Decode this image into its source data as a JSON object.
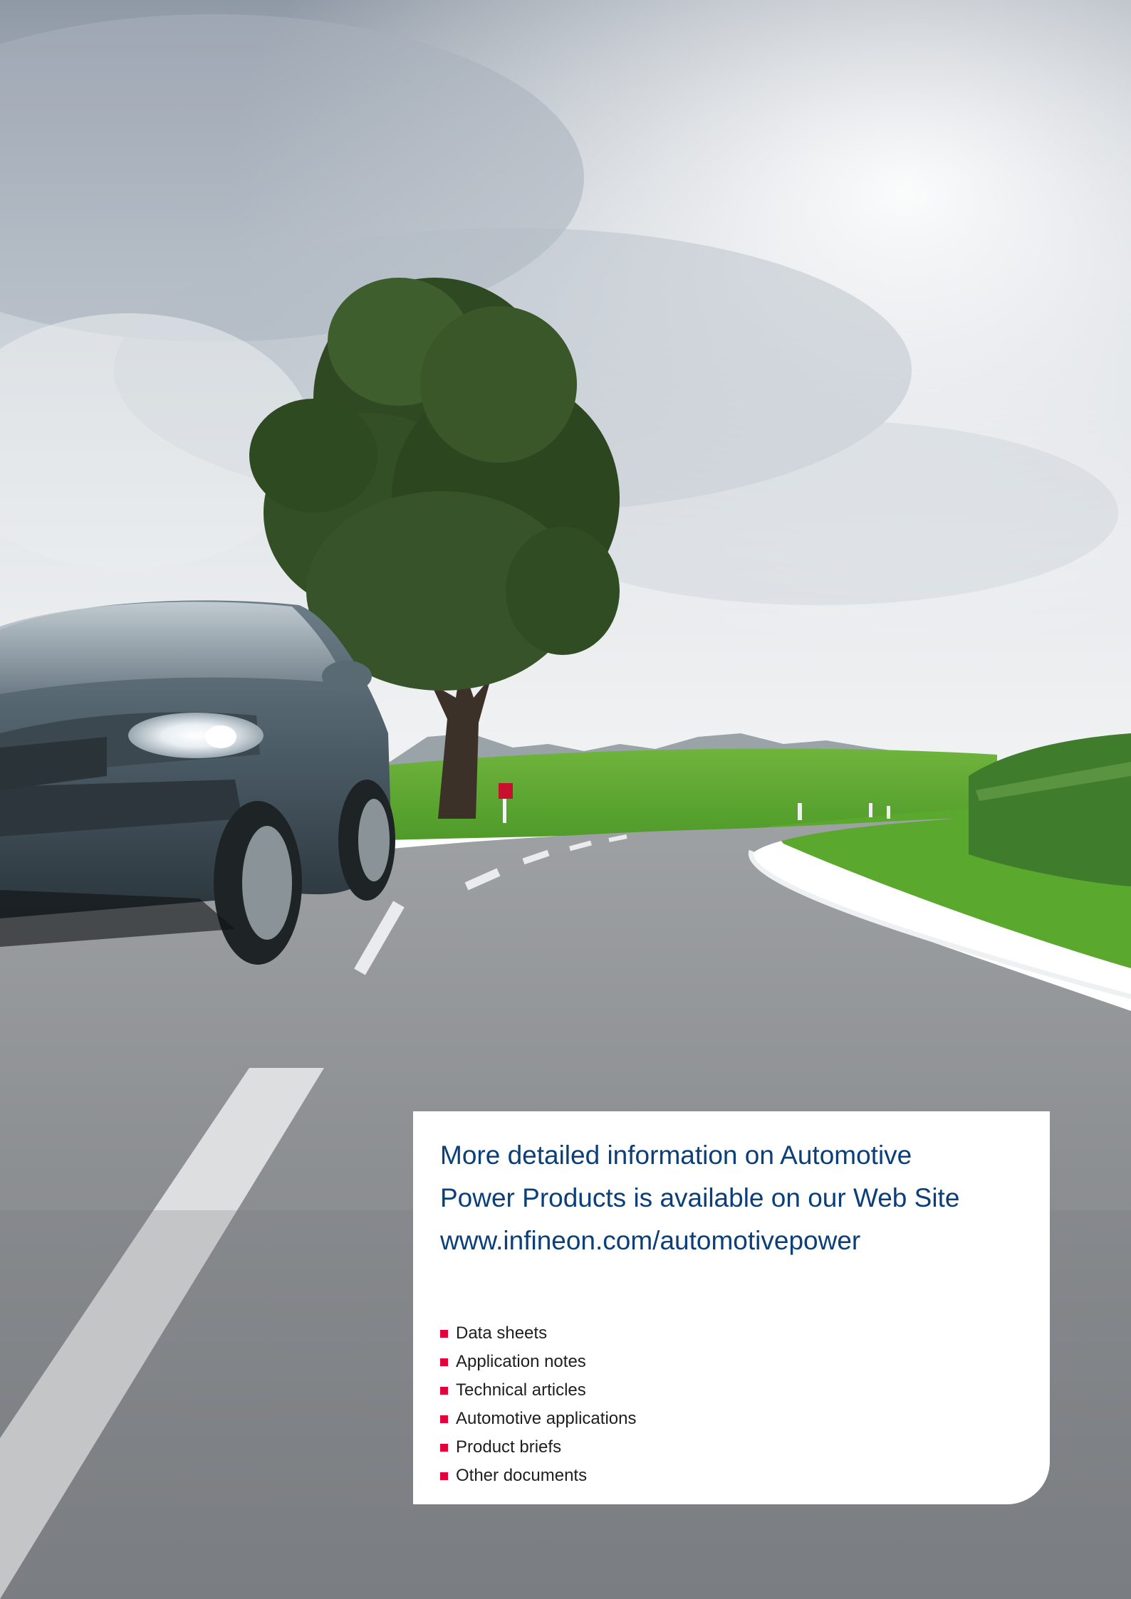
{
  "colors": {
    "heading": "#0b3f7a",
    "bullet": "#e3003a",
    "list_text": "#1e1e1e",
    "card": "#ffffff"
  },
  "photo": {
    "subject": "car-on-country-road-with-tree"
  },
  "info_box": {
    "heading_lines": [
      "More detailed information on Automotive",
      "Power Products is available on our Web Site",
      "www.infineon.com/automotivepower"
    ],
    "items": [
      "Data sheets",
      "Application notes",
      "Technical articles",
      "Automotive applications",
      "Product briefs",
      "Other documents"
    ]
  }
}
